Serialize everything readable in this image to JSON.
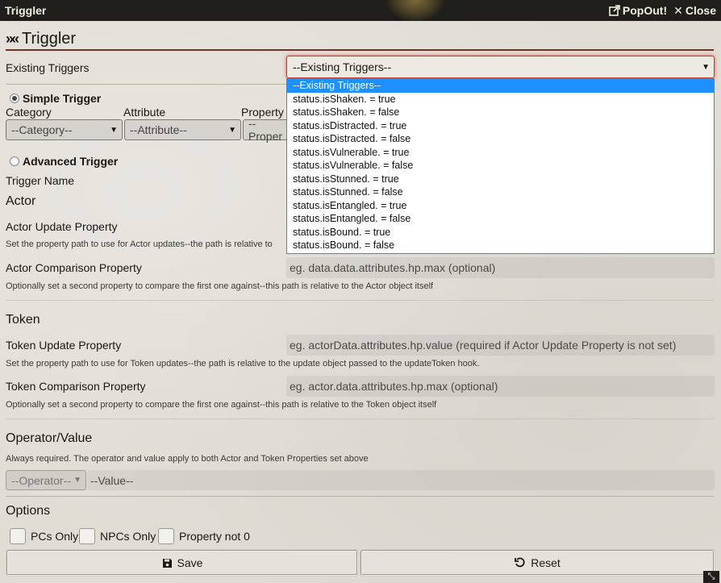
{
  "window": {
    "title": "Triggler",
    "popout_label": "PopOut!",
    "close_label": "Close"
  },
  "header": {
    "title": "Triggler"
  },
  "existing": {
    "label": "Existing Triggers",
    "selected": "--Existing Triggers--",
    "options": [
      "--Existing Triggers--",
      "status.isShaken. = true",
      "status.isShaken. = false",
      "status.isDistracted. = true",
      "status.isDistracted. = false",
      "status.isVulnerable. = true",
      "status.isVulnerable. = false",
      "status.isStunned. = true",
      "status.isStunned. = false",
      "status.isEntangled. = true",
      "status.isEntangled. = false",
      "status.isBound. = true",
      "status.isBound. = false"
    ]
  },
  "simple": {
    "label": "Simple Trigger",
    "category_label": "Category",
    "category_value": "--Category--",
    "attribute_label": "Attribute",
    "attribute_value": "--Attribute--",
    "property_label": "Property",
    "property_value": "--Proper"
  },
  "advanced": {
    "label": "Advanced Trigger"
  },
  "trigger_name": {
    "label": "Trigger Name"
  },
  "actor": {
    "title": "Actor",
    "update_label": "Actor Update Property",
    "update_hint": "Set the property path to use for Actor updates--the path is relative to",
    "comparison_label": "Actor Comparison Property",
    "comparison_placeholder": "eg. data.data.attributes.hp.max (optional)",
    "comparison_hint": "Optionally set a second property to compare the first one against--this path is relative to the Actor object itself"
  },
  "token": {
    "title": "Token",
    "update_label": "Token Update Property",
    "update_placeholder": "eg. actorData.attributes.hp.value (required if Actor Update Property is not set)",
    "update_hint": "Set the property path to use for Token updates--the path is relative to the update object passed to the updateToken hook.",
    "comparison_label": "Token Comparison Property",
    "comparison_placeholder": "eg. actor.data.attributes.hp.max (optional)",
    "comparison_hint": "Optionally set a second property to compare the first one against--this path is relative to the Token object itself"
  },
  "operator": {
    "title": "Operator/Value",
    "hint": "Always required. The operator and value apply to both Actor and Token Properties set above",
    "operator_value": "--Operator--",
    "value_placeholder": "--Value--"
  },
  "options": {
    "title": "Options",
    "pcs_only": "PCs Only",
    "npcs_only": "NPCs Only",
    "property_not_0": "Property not 0"
  },
  "buttons": {
    "save": "Save",
    "reset": "Reset"
  },
  "colors": {
    "accent": "#782e22",
    "selection": "#1e90ff",
    "titlebar": "#1f1e1b"
  }
}
